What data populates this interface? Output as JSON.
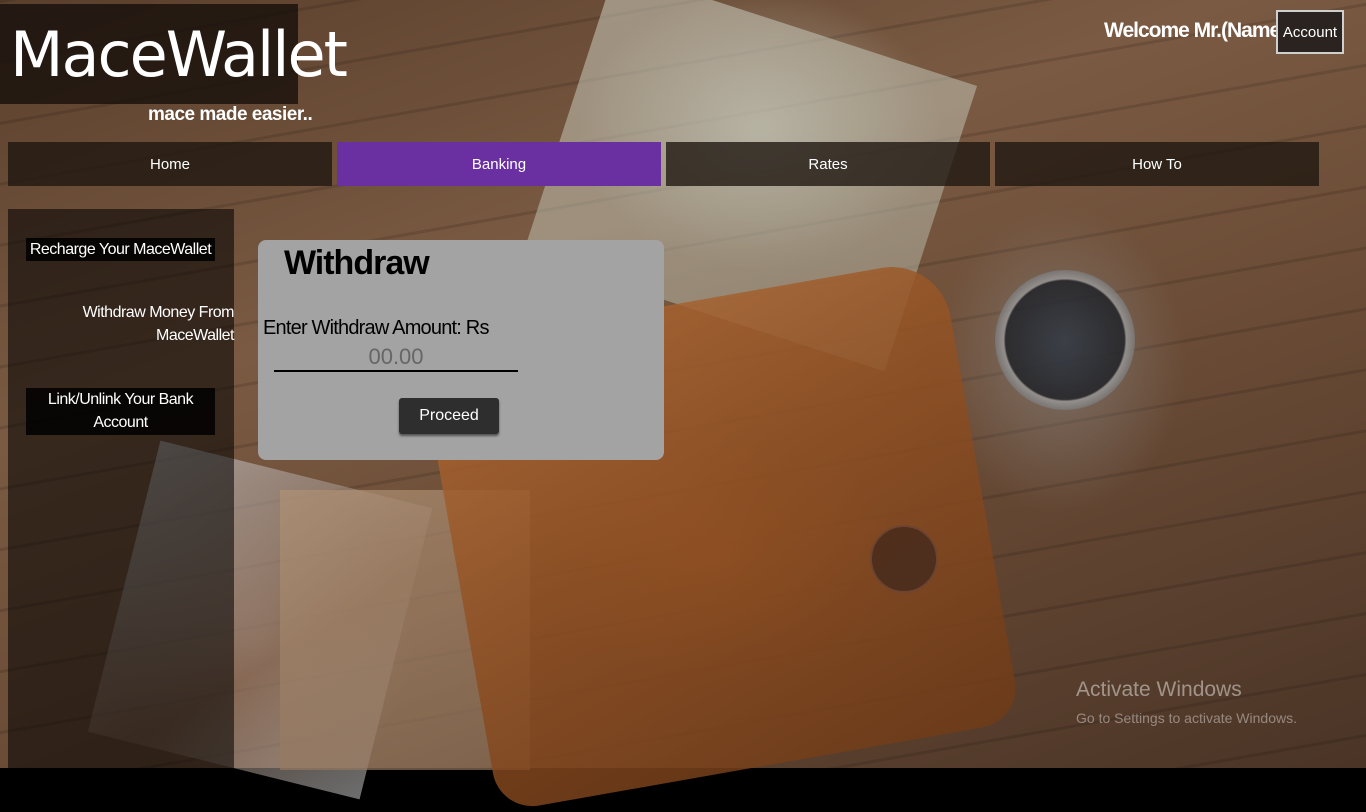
{
  "brand": {
    "title": "MaceWallet",
    "tagline": "mace made easier.."
  },
  "header": {
    "welcome": "Welcome Mr.(Name)",
    "account_label": "Account"
  },
  "nav": {
    "home": "Home",
    "banking": "Banking",
    "rates": "Rates",
    "howto": "How To",
    "active": "Banking",
    "active_color": "#6a2fa0"
  },
  "sidebar": {
    "items": [
      {
        "label": "Recharge Your MaceWallet"
      },
      {
        "label": "Withdraw Money From MaceWallet"
      },
      {
        "label": "Link/Unlink Your Bank Account"
      }
    ]
  },
  "withdraw": {
    "title": "Withdraw",
    "amount_label": "Enter Withdraw Amount: Rs",
    "amount_placeholder": "00.00",
    "amount_value": "",
    "proceed_label": "Proceed"
  },
  "watermark": {
    "title": "Activate Windows",
    "subtitle": "Go to Settings to activate Windows."
  }
}
